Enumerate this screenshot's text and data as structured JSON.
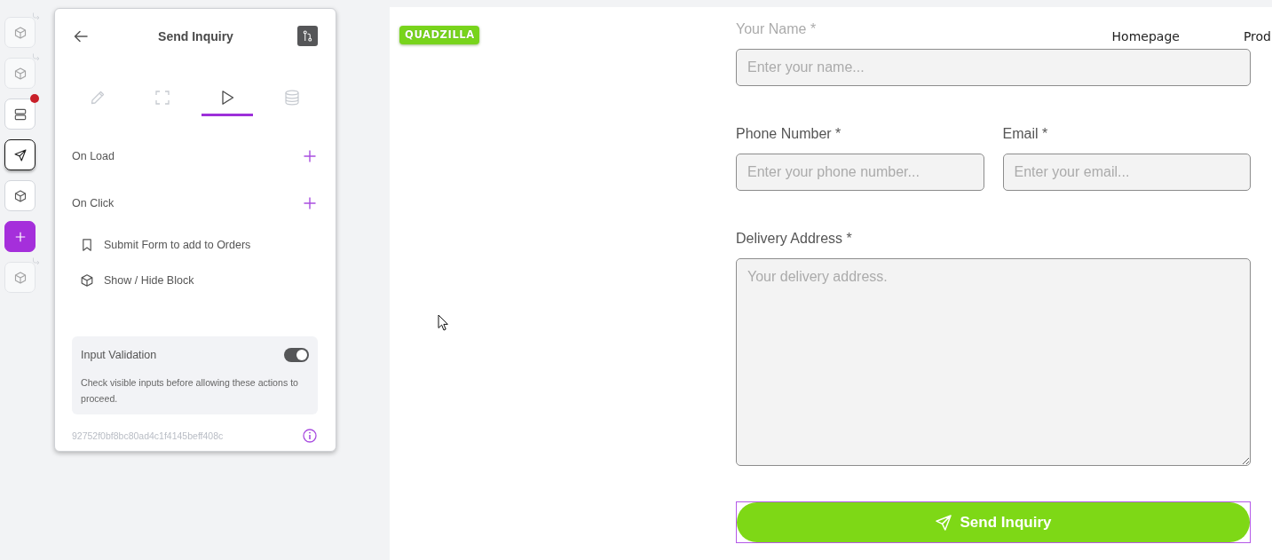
{
  "rail": {
    "items": [
      {
        "kind": "block",
        "dimmed": true,
        "nested": true,
        "badge": false,
        "selected": false
      },
      {
        "kind": "block",
        "dimmed": true,
        "nested": true,
        "badge": false,
        "selected": false
      },
      {
        "kind": "section",
        "dimmed": false,
        "nested": false,
        "badge": true,
        "selected": false
      },
      {
        "kind": "button",
        "dimmed": false,
        "nested": false,
        "badge": false,
        "selected": true
      },
      {
        "kind": "block",
        "dimmed": false,
        "nested": false,
        "badge": false,
        "selected": false
      },
      {
        "kind": "add",
        "dimmed": false,
        "nested": false,
        "badge": false,
        "selected": false
      },
      {
        "kind": "block",
        "dimmed": true,
        "nested": true,
        "badge": false,
        "selected": false
      }
    ]
  },
  "panel": {
    "title": "Send Inquiry",
    "tabs": [
      {
        "kind": "style",
        "selected": false
      },
      {
        "kind": "layout",
        "selected": false
      },
      {
        "kind": "actions",
        "selected": true
      },
      {
        "kind": "data",
        "selected": false
      }
    ],
    "events": [
      {
        "label": "On Load"
      },
      {
        "label": "On Click",
        "actions": [
          {
            "kind": "form",
            "label": "Submit Form to add to Orders"
          },
          {
            "kind": "block",
            "label": "Show / Hide Block"
          }
        ]
      }
    ],
    "validation": {
      "title": "Input Validation",
      "on": true,
      "description": "Check visible inputs before allowing these actions to proceed."
    },
    "block_id": "92752f0bf8bc80ad4c1f4145beff408c"
  },
  "preview": {
    "logo": "QUADZILLA",
    "nav": [
      {
        "label": "Homepage"
      },
      {
        "label": "Prod"
      }
    ],
    "form": {
      "rows": [
        {
          "fields": [
            {
              "kind": "text",
              "label": "Your Name *",
              "placeholder": "Enter your name..."
            }
          ]
        },
        {
          "fields": [
            {
              "kind": "text",
              "label": "Phone Number *",
              "placeholder": "Enter your phone number..."
            },
            {
              "kind": "text",
              "label": "Email *",
              "placeholder": "Enter your email..."
            }
          ]
        },
        {
          "fields": [
            {
              "kind": "textarea",
              "label": "Delivery Address *",
              "placeholder": "Your delivery address."
            }
          ]
        }
      ],
      "submit": {
        "label": "Send Inquiry",
        "selected": true
      }
    }
  }
}
